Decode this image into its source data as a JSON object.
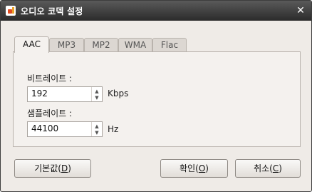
{
  "window": {
    "title": "오디오 코덱 설정",
    "close_icon": "close-icon"
  },
  "tabs": [
    {
      "label": "AAC",
      "active": true
    },
    {
      "label": "MP3",
      "active": false
    },
    {
      "label": "MP2",
      "active": false
    },
    {
      "label": "WMA",
      "active": false
    },
    {
      "label": "Flac",
      "active": false
    }
  ],
  "settings": {
    "bitrate": {
      "label": "비트레이트 :",
      "value": "192",
      "unit": "Kbps"
    },
    "samplerate": {
      "label": "샘플레이트 :",
      "value": "44100",
      "unit": "Hz"
    }
  },
  "buttons": {
    "default": {
      "label": "기본값",
      "mnemonic": "D"
    },
    "ok": {
      "label": "확인",
      "mnemonic": "O"
    },
    "cancel": {
      "label": "취소",
      "mnemonic": "C"
    }
  }
}
